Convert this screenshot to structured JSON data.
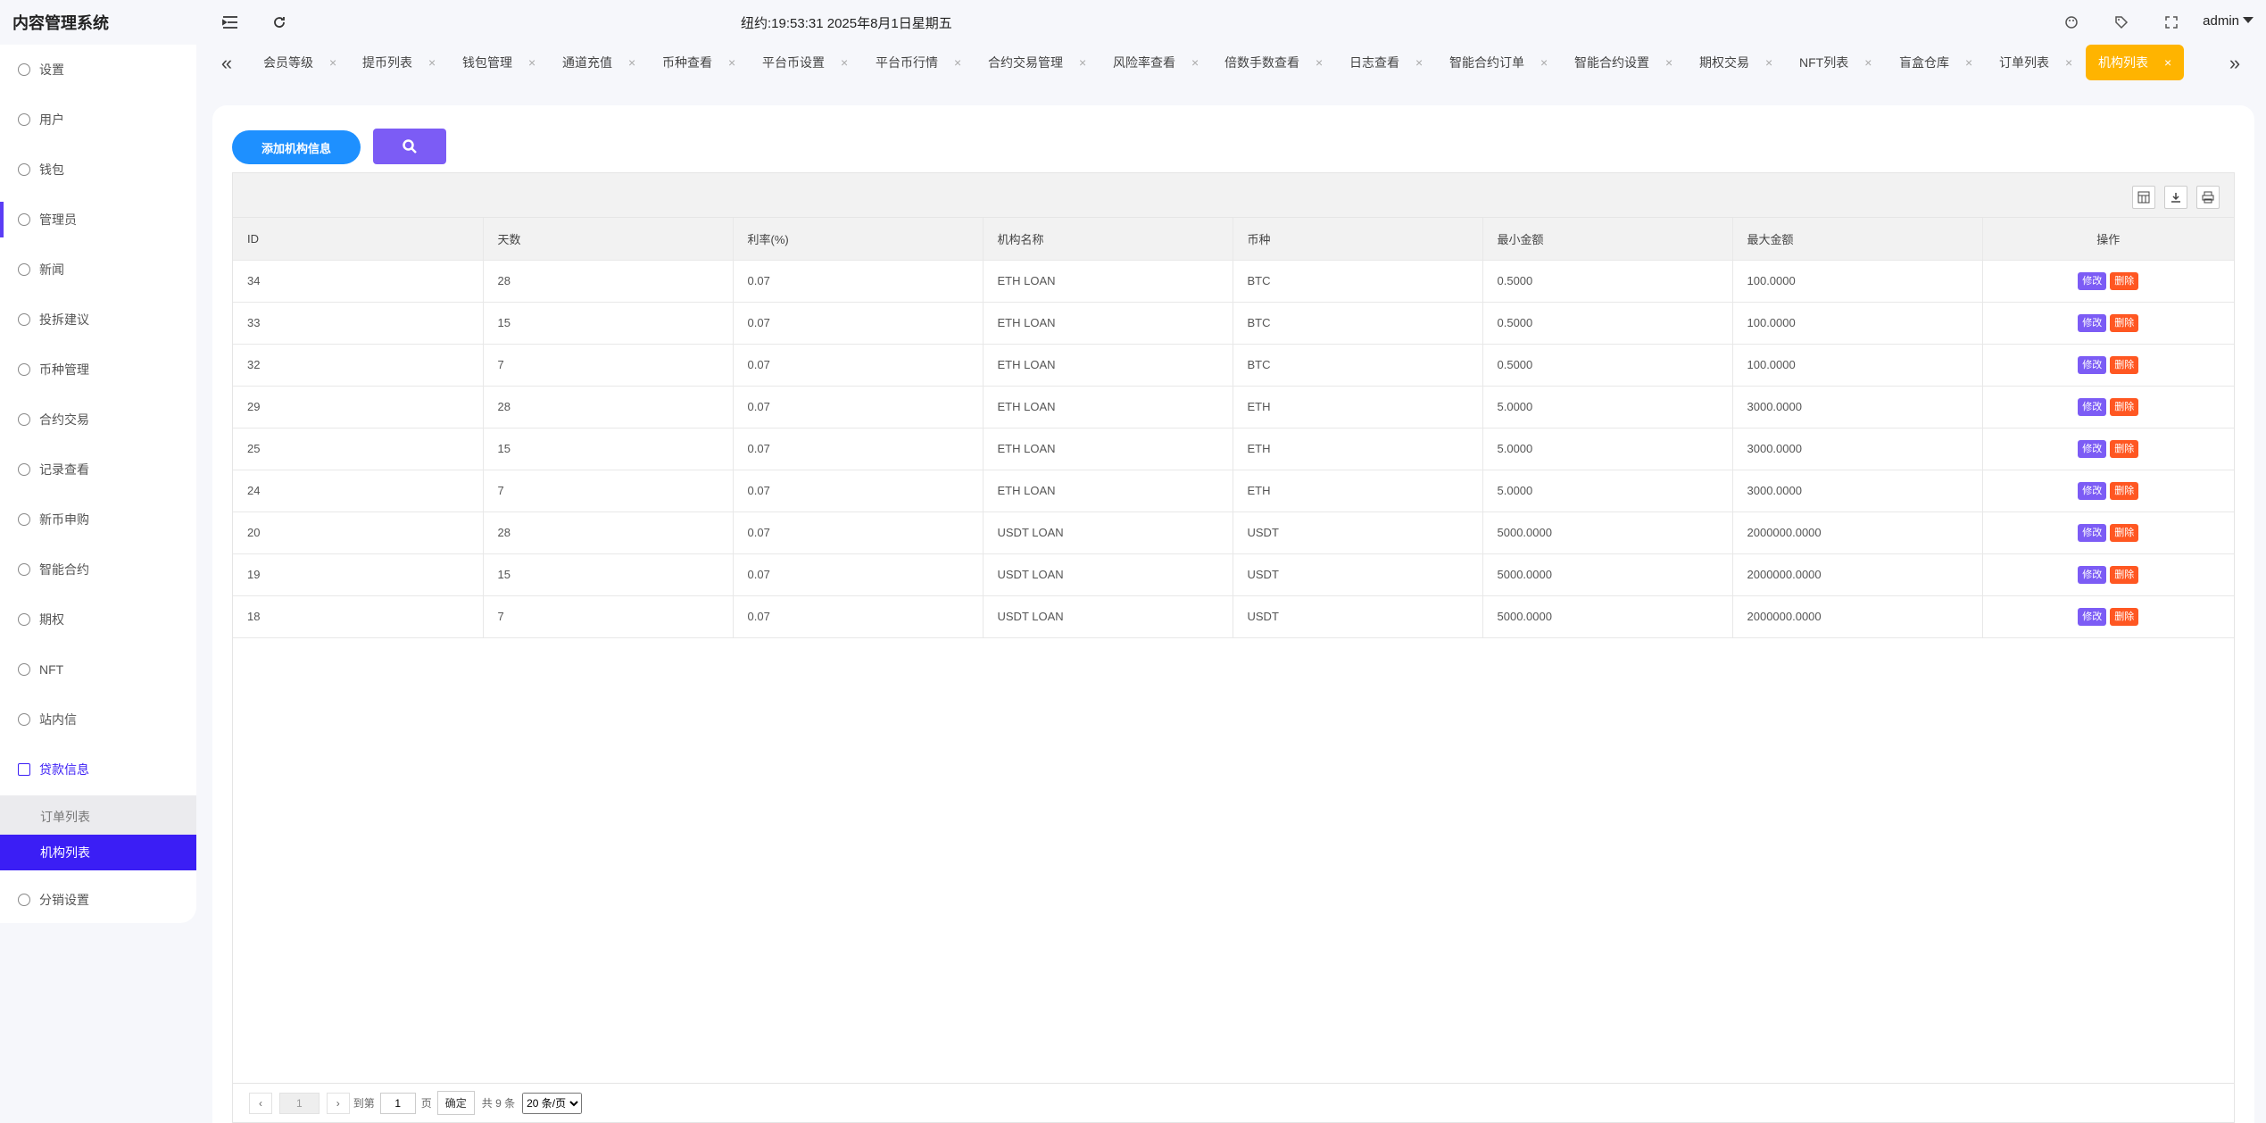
{
  "app": {
    "title": "内容管理系统",
    "clock": "纽约:19:53:31 2025年8月1日星期五",
    "user": "admin"
  },
  "sidebar": {
    "items": [
      {
        "label": "设置",
        "icon": "gear-icon"
      },
      {
        "label": "用户",
        "icon": "user-icon"
      },
      {
        "label": "钱包",
        "icon": "wallet-icon"
      },
      {
        "label": "管理员",
        "icon": "shield-icon"
      },
      {
        "label": "新闻",
        "icon": "tag-icon"
      },
      {
        "label": "投拆建议",
        "icon": "handshake-icon"
      },
      {
        "label": "币种管理",
        "icon": "diamond-icon"
      },
      {
        "label": "合约交易",
        "icon": "diamond-icon"
      },
      {
        "label": "记录查看",
        "icon": "circle-c-icon"
      },
      {
        "label": "新币申购",
        "icon": "coin-icon"
      },
      {
        "label": "智能合约",
        "icon": "circle-c-icon"
      },
      {
        "label": "期权",
        "icon": "circle-c-icon"
      },
      {
        "label": "NFT",
        "icon": "circle-c-icon"
      },
      {
        "label": "站内信",
        "icon": "bell-icon"
      },
      {
        "label": "贷款信息",
        "icon": "document-icon"
      },
      {
        "label": "分销设置",
        "icon": "gear-icon"
      }
    ],
    "sub_items": [
      {
        "label": "订单列表"
      },
      {
        "label": "机构列表"
      }
    ]
  },
  "tabs": [
    {
      "label": "会员等级"
    },
    {
      "label": "提币列表"
    },
    {
      "label": "钱包管理"
    },
    {
      "label": "通道充值"
    },
    {
      "label": "币种查看"
    },
    {
      "label": "平台币设置"
    },
    {
      "label": "平台币行情"
    },
    {
      "label": "合约交易管理"
    },
    {
      "label": "风险率查看"
    },
    {
      "label": "倍数手数查看"
    },
    {
      "label": "日志查看"
    },
    {
      "label": "智能合约订单"
    },
    {
      "label": "智能合约设置"
    },
    {
      "label": "期权交易"
    },
    {
      "label": "NFT列表"
    },
    {
      "label": "盲盒仓库"
    },
    {
      "label": "订单列表"
    },
    {
      "label": "机构列表"
    }
  ],
  "toolbar": {
    "add_label": "添加机构信息"
  },
  "table": {
    "headers": [
      "ID",
      "天数",
      "利率(%)",
      "机构名称",
      "币种",
      "最小金额",
      "最大金额",
      "操作"
    ],
    "edit_label": "修改",
    "delete_label": "删除",
    "rows": [
      [
        "34",
        "28",
        "0.07",
        "ETH LOAN",
        "BTC",
        "0.5000",
        "100.0000"
      ],
      [
        "33",
        "15",
        "0.07",
        "ETH LOAN",
        "BTC",
        "0.5000",
        "100.0000"
      ],
      [
        "32",
        "7",
        "0.07",
        "ETH LOAN",
        "BTC",
        "0.5000",
        "100.0000"
      ],
      [
        "29",
        "28",
        "0.07",
        "ETH LOAN",
        "ETH",
        "5.0000",
        "3000.0000"
      ],
      [
        "25",
        "15",
        "0.07",
        "ETH LOAN",
        "ETH",
        "5.0000",
        "3000.0000"
      ],
      [
        "24",
        "7",
        "0.07",
        "ETH LOAN",
        "ETH",
        "5.0000",
        "3000.0000"
      ],
      [
        "20",
        "28",
        "0.07",
        "USDT LOAN",
        "USDT",
        "5000.0000",
        "2000000.0000"
      ],
      [
        "19",
        "15",
        "0.07",
        "USDT LOAN",
        "USDT",
        "5000.0000",
        "2000000.0000"
      ],
      [
        "18",
        "7",
        "0.07",
        "USDT LOAN",
        "USDT",
        "5000.0000",
        "2000000.0000"
      ]
    ]
  },
  "pager": {
    "current": "1",
    "goto_label": "到第",
    "page_value": "1",
    "page_unit": "页",
    "confirm": "确定",
    "total": "共 9 条",
    "per_page": "20 条/页"
  },
  "colors": {
    "accent": "#3b1ef5",
    "active_tab": "#ffb400",
    "add_button": "#1e90ff",
    "search_button": "#7c5cf5",
    "delete": "#ff5722"
  }
}
